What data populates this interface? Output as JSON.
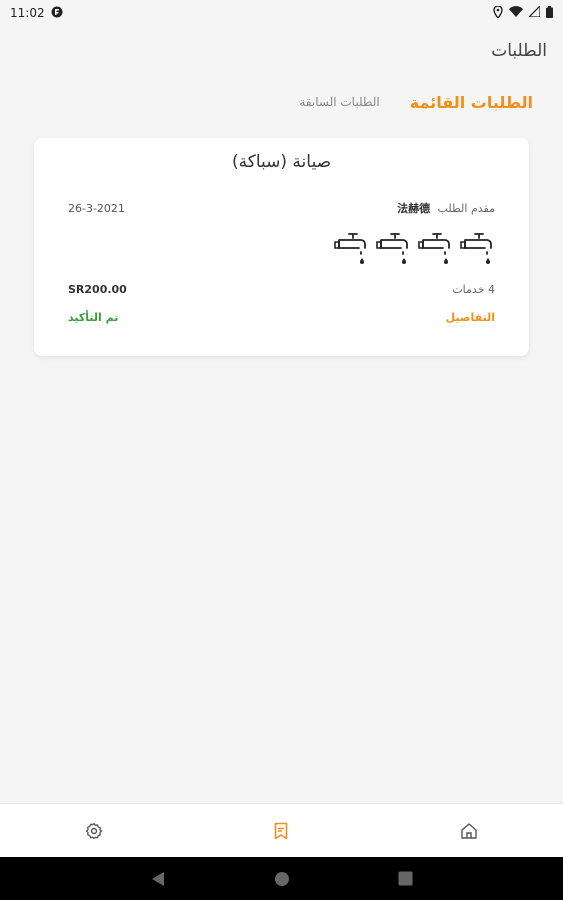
{
  "status_bar": {
    "time": "11:02"
  },
  "app_bar": {
    "title": "الطلبات"
  },
  "tabs": [
    {
      "label": "الطلبات القائمة",
      "active": true
    },
    {
      "label": "الطلبات السابقة",
      "active": false
    }
  ],
  "order": {
    "title": "صيانة (سباكة)",
    "requester_label": "مقدم الطلب",
    "requester_name": "法赫德",
    "date": "26-3-2021",
    "service_icons": [
      "faucet-icon",
      "faucet-icon",
      "faucet-icon",
      "faucet-icon"
    ],
    "services_count": "4 خدمات",
    "price": "SR200.00",
    "details_label": "التفاصيل",
    "status": "تم التأكيد"
  },
  "bottom_nav": [
    {
      "icon": "settings-icon"
    },
    {
      "icon": "orders-icon",
      "active": true
    },
    {
      "icon": "home-icon"
    }
  ],
  "colors": {
    "accent": "#f0901a",
    "success": "#3a9d3a"
  }
}
